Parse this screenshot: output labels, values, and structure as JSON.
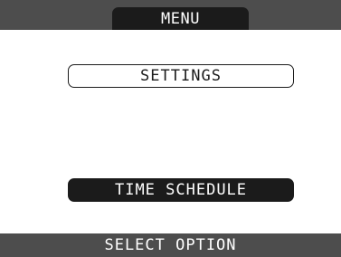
{
  "header": {
    "title": "MENU"
  },
  "menu": {
    "items": [
      {
        "label": "SETTINGS",
        "selected": false
      },
      {
        "label": "TIME SCHEDULE",
        "selected": true
      }
    ]
  },
  "footer": {
    "status": "SELECT OPTION"
  },
  "colors": {
    "bar": "#4d4d4d",
    "dark": "#1b1b1b",
    "background": "#ffffff"
  }
}
